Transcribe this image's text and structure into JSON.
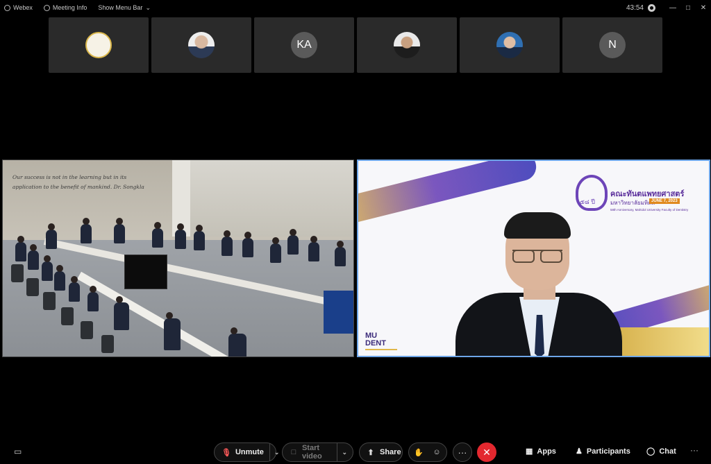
{
  "titlebar": {
    "app_name": "Webex",
    "meeting_info": "Meeting Info",
    "show_menu_bar": "Show Menu Bar",
    "chevron": "⌄",
    "timer": "43:54",
    "minimize": "—",
    "maximize": "□",
    "close": "✕"
  },
  "participants_strip": [
    {
      "initials": "",
      "kind": "seal"
    },
    {
      "initials": "",
      "kind": "photo"
    },
    {
      "initials": "KA",
      "kind": "initials"
    },
    {
      "initials": "",
      "kind": "photo"
    },
    {
      "initials": "",
      "kind": "photo"
    },
    {
      "initials": "N",
      "kind": "initials"
    }
  ],
  "left_video": {
    "wall_quote": "Our success is not in the learning but in its application to the benefit of mankind. Dr. Songkla"
  },
  "right_video": {
    "logo_number": "๕๘ ปี",
    "faculty_name": "คณะทันตแพทยศาสตร์",
    "university_name": "มหาวิทยาลัยมหิดล",
    "date_badge": "JUNE 7, 2023",
    "anniversary_line": "58th Anniversary, Mahidol University Faculty of Dentistry",
    "brand_mu": "MU",
    "brand_dent": "DENT"
  },
  "toolbar": {
    "unmute_label": "Unmute",
    "start_video_label": "Start video",
    "share_label": "Share",
    "apps_label": "Apps",
    "participants_label": "Participants",
    "chat_label": "Chat",
    "more_glyph": "···",
    "leave_glyph": "✕"
  },
  "colors": {
    "leave_button": "#e3282f",
    "active_speaker_border": "#6ea6e8",
    "muted_mic": "#ff5a5a"
  }
}
